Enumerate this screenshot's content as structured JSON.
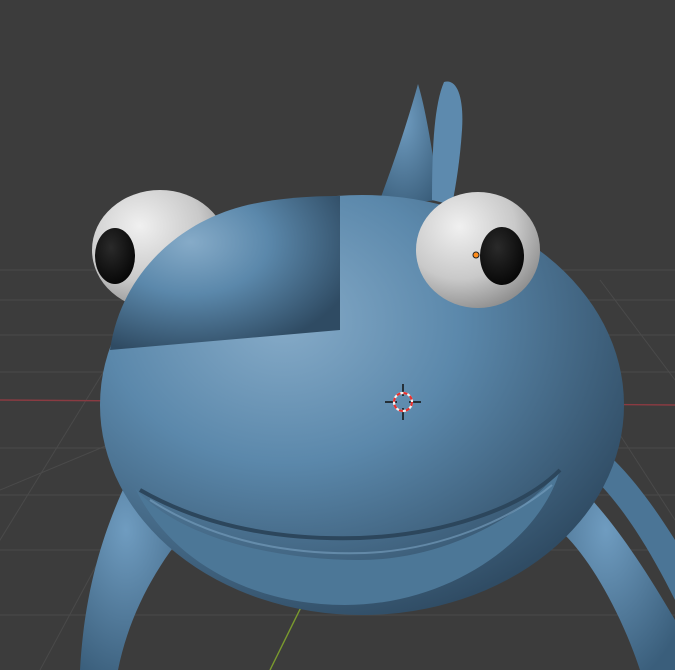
{
  "viewport": {
    "background": "#3c3c3c",
    "grid_color": "#4a4a4a",
    "x_axis_color": "#8a3b42",
    "y_axis_color": "#7a9a2e"
  },
  "model": {
    "body_color": "#5b88ab",
    "body_highlight": "#86abc8",
    "body_shadow": "#2f4b63",
    "eye_white": "#d8d8d8",
    "pupil": "#141414"
  },
  "origin_dot_color": "#ff8c1a",
  "cursor_3d": {
    "ring_red": "#e8312f",
    "ring_white": "#f2f2f2",
    "crosshair": "#111111"
  }
}
